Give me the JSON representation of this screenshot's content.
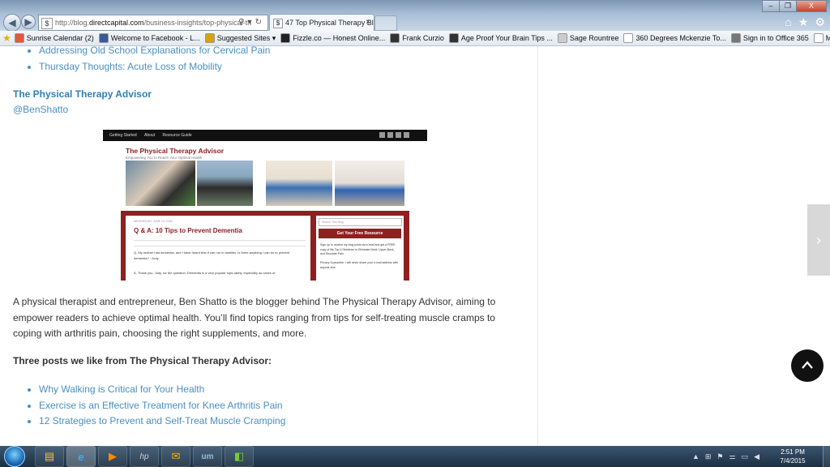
{
  "browser": {
    "address": {
      "url_prefix": "http://blog.",
      "url_domain": "directcapital.com",
      "url_rest": "/business-insights/top-physical-th"
    },
    "tab": {
      "title": "47 Top Physical Therapy Bl...",
      "close": "×"
    },
    "window_controls": {
      "minimize": "–",
      "maximize": "❐",
      "close": "X"
    },
    "favorites": [
      {
        "label": "Sunrise Calendar (2)",
        "icon_color": "#e8553b"
      },
      {
        "label": "Welcome to Facebook - L...",
        "icon_color": "#3b5998"
      },
      {
        "label": "Suggested Sites ▾",
        "icon_color": "#d6a500"
      },
      {
        "label": "Fizzle.co — Honest Online...",
        "icon_color": "#222222"
      },
      {
        "label": "Frank Curzio",
        "icon_color": "#333333"
      },
      {
        "label": "Age Proof Your Brain Tips ...",
        "icon_color": "#333333"
      },
      {
        "label": "Sage Rountree",
        "icon_color": "#cccccc"
      },
      {
        "label": "360 Degrees Mckenzie  To...",
        "icon_color": "#ffffff"
      },
      {
        "label": "Sign in to Office 365",
        "icon_color": "#777777"
      },
      {
        "label": "Multicare",
        "icon_color": "#ffffff"
      }
    ]
  },
  "page": {
    "top_links": [
      "Addressing Old School Explanations for Cervical Pain",
      "Thursday Thoughts: Acute Loss of Mobility"
    ],
    "blog_name": "The Physical Therapy Advisor",
    "blog_handle": "@BenShatto",
    "description": "A physical therapist and entrepreneur, Ben Shatto is the blogger behind The Physical Therapy Advisor, aiming to empower readers to achieve optimal health. You’ll find topics ranging from tips for self-treating muscle cramps to coping with arthritis pain, choosing the right supplements, and more.",
    "section_heading": "Three posts we like from The Physical Therapy Advisor:",
    "bottom_links": [
      "Why Walking is Critical for Your Health",
      "Exercise is an Effective Treatment for Knee Arthritis Pain",
      "12 Strategies to Prevent and Self-Treat Muscle Cramping"
    ],
    "blog_screenshot": {
      "nav": [
        "Getting Started",
        "About",
        "Resource Guide"
      ],
      "title": "The Physical Therapy Advisor",
      "tagline": "Empowering You to Reach Your Optimal Health",
      "post_date": "WEDNESDAY, JUNE 24, 2015",
      "post_title": "Q & A: 10 Tips to Prevent Dementia",
      "post_question": "Q.  My mother had dementia, and I have heard that it can run in families. Is there anything I can do to prevent dementia?  ~Judy",
      "post_answer": "A.  Thank you, Judy, for the question. Dementia is a very popular topic lately, especially as cases of",
      "search_placeholder": "Search This Blog",
      "resource_heading": "Get Your Free Resource",
      "resource_text": "Sign up to receive my blog posts via e-mail and get a FREE copy of My Top 6 Stretches to Eliminate Neck, Upper Back, and Shoulder Pain.",
      "resource_privacy": "Privacy Guarantee: I will never share your e-mail address with anyone else."
    }
  },
  "taskbar": {
    "clock_time": "2:51 PM",
    "clock_date": "7/4/2015"
  },
  "colors": {
    "link": "#4a8fbf",
    "blog_name": "#2f7fb6",
    "body_text": "#333333",
    "blog_accent": "#8f2020"
  }
}
